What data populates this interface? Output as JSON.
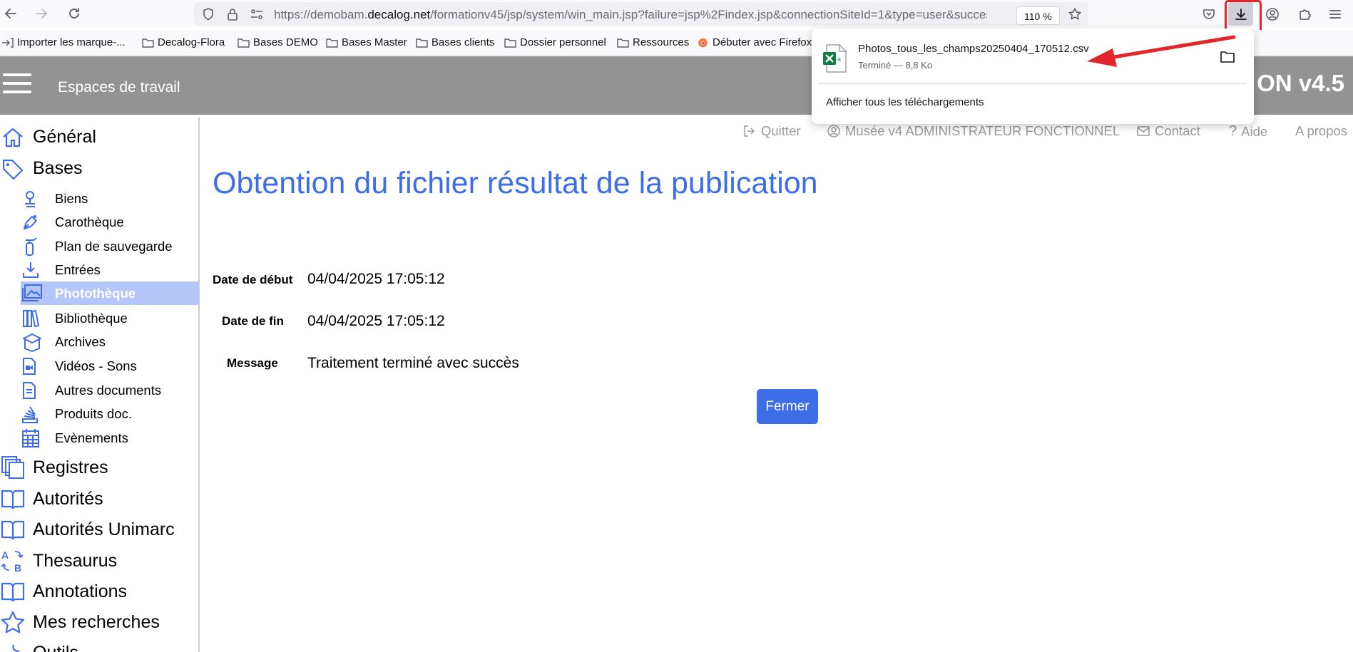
{
  "browser": {
    "url_prefix": "https://demobam.",
    "url_domain": "decalog.net",
    "url_suffix": "/formationv45/jsp/system/win_main.jsp?failure=jsp%2Findex.jsp&connectionSiteId=1&type=user&succes",
    "zoom": "110 %"
  },
  "bookmarks": [
    {
      "label": "Importer les marque-..."
    },
    {
      "label": "Decalog-Flora"
    },
    {
      "label": "Bases DEMO"
    },
    {
      "label": "Bases Master"
    },
    {
      "label": "Bases clients"
    },
    {
      "label": "Dossier personnel"
    },
    {
      "label": "Ressources"
    },
    {
      "label": "Débuter avec Firefox"
    }
  ],
  "download_panel": {
    "filename": "Photos_tous_les_champs20250404_170512.csv",
    "status": "Terminé — 8,8 Ko",
    "show_all": "Afficher tous les téléchargements"
  },
  "header": {
    "workspace": "Espaces de travail",
    "version": "ON v4.5"
  },
  "top_links": {
    "quit": "Quitter",
    "user": "Musée v4 ADMINISTRATEUR FONCTIONNEL",
    "contact": "Contact",
    "help": "Aide",
    "about": "A propos"
  },
  "sidebar": {
    "general": "Général",
    "bases": "Bases",
    "sub": [
      "Biens",
      "Carothèque",
      "Plan de sauvegarde",
      "Entrées",
      "Photothèque",
      "Bibliothèque",
      "Archives",
      "Vidéos - Sons",
      "Autres documents",
      "Produits doc.",
      "Evènements"
    ],
    "registres": "Registres",
    "autorites": "Autorités",
    "autorites_unimarc": "Autorités Unimarc",
    "thesaurus": "Thesaurus",
    "annotations": "Annotations",
    "mes_recherches": "Mes recherches",
    "outils": "Outils"
  },
  "main": {
    "title": "Obtention du fichier résultat de la publication",
    "start_label": "Date de début",
    "start_value": "04/04/2025 17:05:12",
    "end_label": "Date de fin",
    "end_value": "04/04/2025 17:05:12",
    "message_label": "Message",
    "message_value": "Traitement terminé avec succès",
    "close_button": "Fermer"
  },
  "colors": {
    "accent": "#3d6ee8",
    "header_bg": "#939393",
    "active_bg": "#b3c6f7",
    "annotation": "#e3262b"
  }
}
